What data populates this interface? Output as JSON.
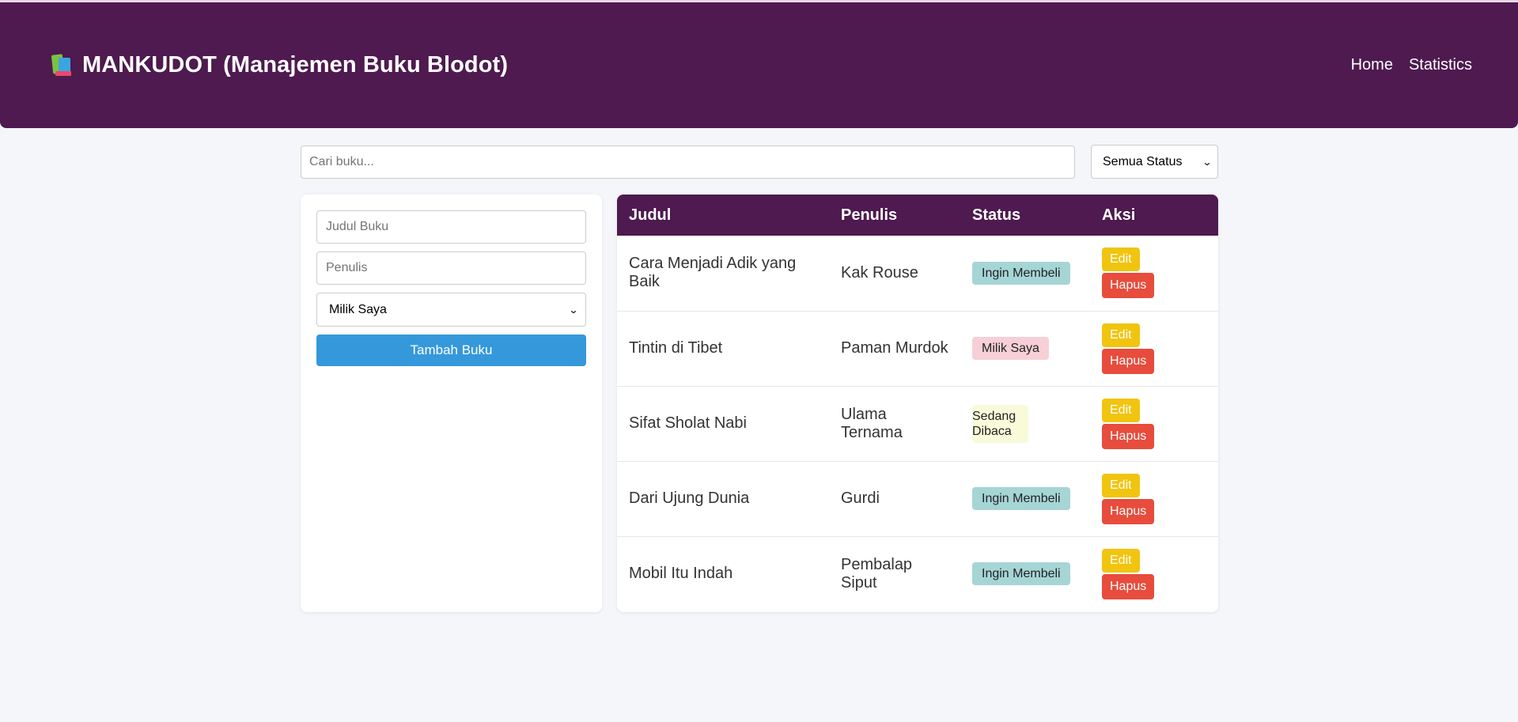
{
  "header": {
    "title": "MANKUDOT (Manajemen Buku Blodot)",
    "icon": "books-icon",
    "nav": [
      "Home",
      "Statistics"
    ],
    "color": "#4e1a4f"
  },
  "search": {
    "placeholder": "Cari buku...",
    "value": ""
  },
  "filter": {
    "selected": "Semua Status"
  },
  "form": {
    "title_placeholder": "Judul Buku",
    "author_placeholder": "Penulis",
    "status_selected": "Milik Saya",
    "submit_label": "Tambah Buku",
    "submit_color": "#3498db"
  },
  "table": {
    "columns": [
      "Judul",
      "Penulis",
      "Status",
      "Aksi"
    ],
    "rows": [
      {
        "title": "Cara Menjadi Adik yang Baik",
        "author": "Kak Rouse",
        "status": "Ingin Membeli"
      },
      {
        "title": "Tintin di Tibet",
        "author": "Paman Murdok",
        "status": "Milik Saya"
      },
      {
        "title": "Sifat Sholat Nabi",
        "author": "Ulama Ternama",
        "status": "Sedang Dibaca"
      },
      {
        "title": "Dari Ujung Dunia",
        "author": "Gurdi",
        "status": "Ingin Membeli"
      },
      {
        "title": "Mobil Itu Indah",
        "author": "Pembalap Siput",
        "status": "Ingin Membeli"
      }
    ],
    "edit_label": "Edit",
    "delete_label": "Hapus",
    "status_colors": {
      "Ingin Membeli": "#a6d5d6",
      "Milik Saya": "#f6cfd7",
      "Sedang Dibaca": "#f8fad9"
    },
    "edit_color": "#f1c40f",
    "delete_color": "#e74c3c"
  }
}
